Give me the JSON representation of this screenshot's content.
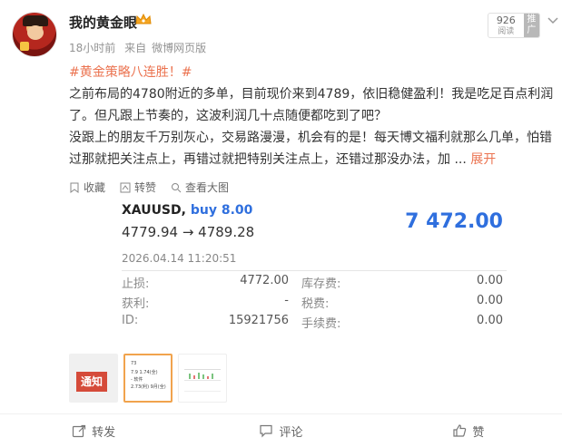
{
  "post": {
    "username": "我的黄金眼",
    "time": "18小时前",
    "source_prefix": "来自",
    "source": "微博网页版",
    "read_count": "926",
    "read_label": "阅读",
    "promo_label": "推广",
    "hashtag": "#黄金策略八连胜！#",
    "paragraph1": "之前布局的4780附近的多单，目前现价来到4789，依旧稳健盈利！我是吃足百点利润了。但凡跟上节奏的，这波利润几十点随便都吃到了吧？",
    "paragraph2": "没跟上的朋友千万别灰心，交易路漫漫，机会有的是！每天博文福利就那么几单，怕错过那就把关注点上，再错过就把特别关注点上，还错过那没办法，加 ...",
    "expand_label": "展开"
  },
  "actions": {
    "favorite": "收藏",
    "repost_inline": "转赞",
    "view_large": "查看大图"
  },
  "trade": {
    "symbol": "XAUUSD,",
    "side": "buy 8.00",
    "price_open": "4779.94",
    "arrow": "→",
    "price_current": "4789.28",
    "profit": "7 472.00",
    "datetime": "2026.04.14 11:20:51",
    "rows": [
      {
        "k1": "止损:",
        "v1": "4772.00",
        "k2": "库存费:",
        "v2": "0.00"
      },
      {
        "k1": "获利:",
        "v1": "-",
        "k2": "税费:",
        "v2": "0.00"
      },
      {
        "k1": "ID:",
        "v1": "15921756",
        "k2": "手续费:",
        "v2": "0.00"
      }
    ]
  },
  "thumbs": {
    "t1_text": "通知",
    "t2_lines": [
      "73",
      "7.9 1.74(全)",
      "- 软件",
      "2.73(利) 9月(全)"
    ]
  },
  "footer": {
    "share": "转发",
    "comment": "评论",
    "like": "赞"
  },
  "colors": {
    "accent": "#eb7350",
    "profit_blue": "#2f6fde",
    "muted": "#939393"
  }
}
